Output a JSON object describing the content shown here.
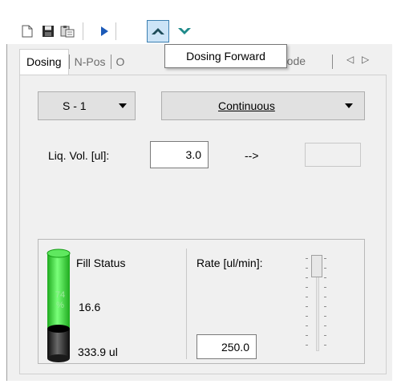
{
  "toolbar": {
    "buttons": [
      {
        "name": "new-icon"
      },
      {
        "name": "save-icon"
      },
      {
        "name": "paste-icon"
      },
      {
        "name": "play-icon"
      },
      {
        "name": "dosing-forward-icon",
        "active": true
      },
      {
        "name": "dosing-backward-icon"
      }
    ]
  },
  "tooltip": {
    "text": "Dosing Forward"
  },
  "tabs": {
    "items": [
      {
        "label": "Dosing"
      },
      {
        "label": "N-Pos"
      },
      {
        "label": "O"
      },
      {
        "label": "Mode"
      }
    ],
    "scroll_left": "◁",
    "scroll_right": "▷"
  },
  "syringe_select": {
    "value": "S - 1"
  },
  "mode_select": {
    "value": "Continuous"
  },
  "liquid": {
    "label": "Liq. Vol.  [ul]:",
    "value": "3.0",
    "arrow": "-->",
    "target_value": ""
  },
  "fill": {
    "label": "Fill Status",
    "percent_text": "74 %",
    "percent_value": 74,
    "current": "16.6",
    "total": "333.9 ul"
  },
  "rate": {
    "label": "Rate [ul/min]:",
    "value": "250.0"
  },
  "colors": {
    "accent": "#3c7fb1",
    "fill_green": "#33d533",
    "cylinder_dark": "#1a1a1a"
  }
}
